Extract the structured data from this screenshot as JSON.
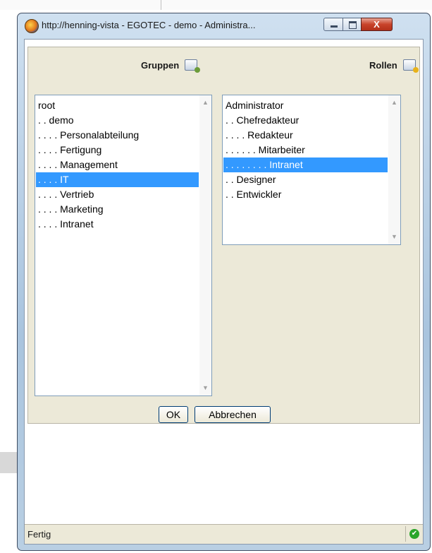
{
  "window": {
    "title": "http://henning-vista - EGOTEC - demo - Administra...",
    "close_glyph": "X"
  },
  "groups": {
    "header": "Gruppen",
    "icon": "group-icon",
    "items": [
      {
        "label": "root",
        "selected": false
      },
      {
        "label": ". . demo",
        "selected": false
      },
      {
        "label": ". . . . Personalabteilung",
        "selected": false
      },
      {
        "label": ". . . . Fertigung",
        "selected": false
      },
      {
        "label": ". . . . Management",
        "selected": false
      },
      {
        "label": ". . . . IT",
        "selected": true
      },
      {
        "label": ". . . . Vertrieb",
        "selected": false
      },
      {
        "label": ". . . . Marketing",
        "selected": false
      },
      {
        "label": ". . . . Intranet",
        "selected": false
      }
    ]
  },
  "roles": {
    "header": "Rollen",
    "icon": "role-icon",
    "items": [
      {
        "label": "Administrator",
        "selected": false
      },
      {
        "label": ". . Chefredakteur",
        "selected": false
      },
      {
        "label": ". . . . Redakteur",
        "selected": false
      },
      {
        "label": ". . . . . . Mitarbeiter",
        "selected": false
      },
      {
        "label": ". . . . . . . . Intranet",
        "selected": true
      },
      {
        "label": ". . Designer",
        "selected": false
      },
      {
        "label": ". . Entwickler",
        "selected": false
      }
    ]
  },
  "buttons": {
    "ok": "OK",
    "cancel": "Abbrechen"
  },
  "status": {
    "text": "Fertig",
    "icon": "check-icon",
    "icon_glyph": "✔"
  },
  "colors": {
    "selection": "#3399ff",
    "panel": "#ece9d8"
  }
}
